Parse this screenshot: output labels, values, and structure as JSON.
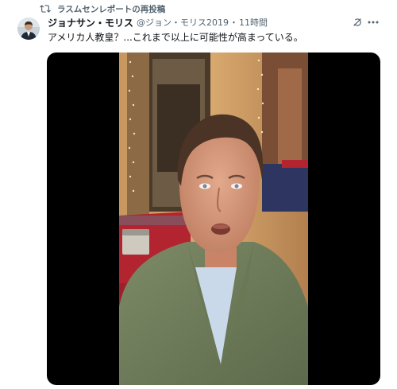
{
  "repost": {
    "label": "ラスムセンレポートの再投稿",
    "icon": "repost-icon"
  },
  "post": {
    "display_name": "ジョナサン・モリス",
    "handle": "@ジョン・モリス2019",
    "separator": "・",
    "time": "11時間",
    "text": "アメリカ人教皇？...これまで以上に可能性が高まっている。",
    "avatar_icon": "avatar",
    "grok_icon": "grok-icon",
    "more_icon": "more-icon"
  },
  "media": {
    "type": "video",
    "icon": "video-thumbnail"
  },
  "colors": {
    "secondary_text": "#536471",
    "primary_text": "#0f1419",
    "media_background": "#000000"
  }
}
